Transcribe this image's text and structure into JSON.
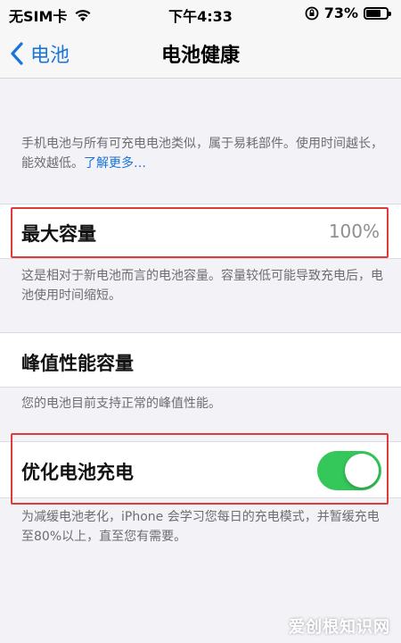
{
  "status_bar": {
    "carrier": "无SIM卡",
    "time": "下午4:33",
    "battery_percent": "73%",
    "battery_level": 0.73
  },
  "nav": {
    "back_label": "电池",
    "title": "电池健康"
  },
  "intro": {
    "text": "手机电池与所有可充电电池类似，属于易耗部件。使用时间越长，能效越低。",
    "link": "了解更多…"
  },
  "max_capacity": {
    "label": "最大容量",
    "value": "100%",
    "description": "这是相对于新电池而言的电池容量。容量较低可能导致充电后，电池使用时间缩短。"
  },
  "peak_performance": {
    "label": "峰值性能容量",
    "description": "您的电池目前支持正常的峰值性能。"
  },
  "optimized_charging": {
    "label": "优化电池充电",
    "enabled": true,
    "description": "为减缓电池老化，iPhone 会学习您每日的充电模式，并暂缓充电至80%以上，直至您有需要。"
  },
  "colors": {
    "accent": "#1976d8",
    "toggle_on": "#34c759",
    "highlight": "#e03a3a"
  },
  "watermark": "爱创根知识网"
}
